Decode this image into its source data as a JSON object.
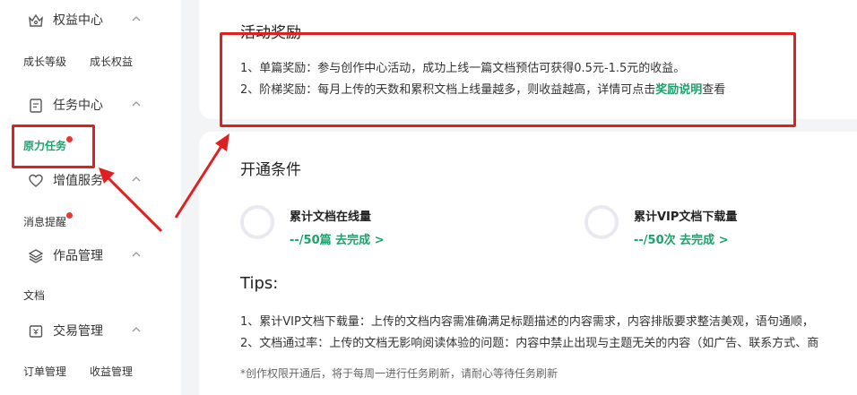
{
  "sidebar": {
    "sections": [
      {
        "label": "权益中心",
        "icon": "crown-icon",
        "subs": [
          "成长等级",
          "成长权益"
        ]
      },
      {
        "label": "任务中心",
        "icon": "document-icon",
        "subs": [
          "原力任务"
        ]
      },
      {
        "label": "增值服务",
        "icon": "heart-icon",
        "subs": [
          "消息提醒"
        ]
      },
      {
        "label": "作品管理",
        "icon": "layers-icon",
        "subs": [
          "文档"
        ]
      },
      {
        "label": "交易管理",
        "icon": "wallet-icon",
        "subs": [
          "订单管理",
          "收益管理"
        ]
      }
    ],
    "active_item": "原力任务"
  },
  "reward": {
    "title": "活动奖励",
    "line1": "1、单篇奖励：参与创作中心活动，成功上线一篇文档预估可获得0.5元-1.5元的收益。",
    "line2_prefix": "2、阶梯奖励：每月上传的天数和累积文档上线量越多，则收益越高，详情可点击",
    "line2_link": "奖励说明",
    "line2_suffix": "查看"
  },
  "conditions": {
    "title": "开通条件",
    "items": [
      {
        "title": "累计文档在线量",
        "progress": "--/50篇",
        "action": "去完成 >"
      },
      {
        "title": "累计VIP文档下载量",
        "progress": "--/50次",
        "action": "去完成 >"
      }
    ]
  },
  "tips": {
    "title": "Tips:",
    "items": [
      "1、累计VIP文档下载量：上传的文档内容需准确满足标题描述的内容需求，内容排版要求整洁美观，语句通顺，",
      "2、文档通过率：上传的文档无影响阅读体验的问题：内容中禁止出现与主题无关的内容（如广告、联系方式、商"
    ],
    "note": "*创作权限开通后，将于每周一进行任务刷新，请耐心等待任务刷新"
  },
  "colors": {
    "accent": "#1aa36b",
    "annotation": "#e02020",
    "badge": "#e53935"
  }
}
